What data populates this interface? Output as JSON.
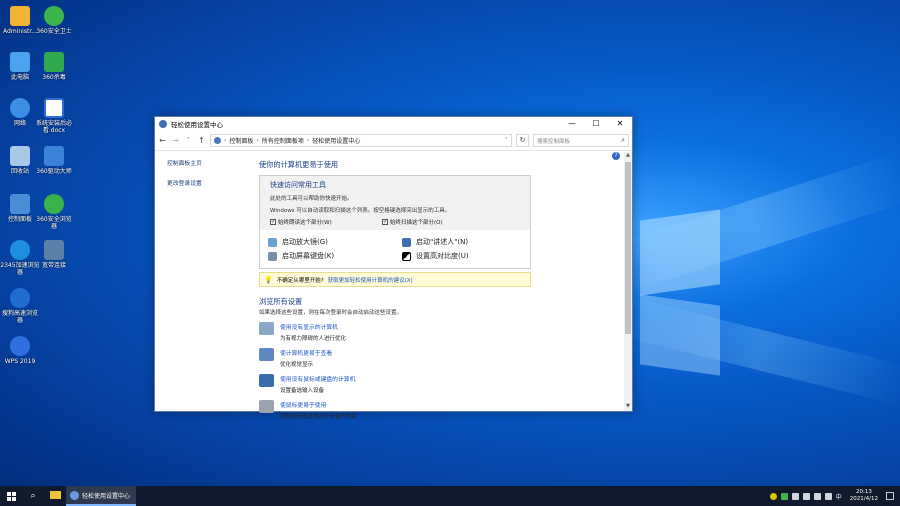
{
  "desktop": {
    "icons": [
      {
        "label": "Administr...",
        "color": "#f2b233"
      },
      {
        "label": "360安全卫士",
        "color": "#3bb54a"
      },
      {
        "label": "此电脑",
        "color": "#4aa3f0"
      },
      {
        "label": "360杀毒",
        "color": "#2fa84f"
      },
      {
        "label": "网络",
        "color": "#3d8ee6"
      },
      {
        "label": "系统安装后必看.docx",
        "color": "#2f6fd4"
      },
      {
        "label": "回收站",
        "color": "#a8c8e8"
      },
      {
        "label": "360驱动大师",
        "color": "#3b83d9"
      },
      {
        "label": "控制面板",
        "color": "#4a8ed8"
      },
      {
        "label": "360安全浏览器",
        "color": "#39b34a"
      },
      {
        "label": "2345加速浏览器",
        "color": "#1e8ee0"
      },
      {
        "label": "宽带连接",
        "color": "#5c7fa8"
      },
      {
        "label": "搜狗高速浏览器",
        "color": "#1f6ecf"
      },
      {
        "label": "WPS 2019",
        "color": "#2f6fe0"
      }
    ]
  },
  "window": {
    "title": "轻松使用设置中心",
    "controls": {
      "minimize": "—",
      "maximize": "☐",
      "close": "✕"
    },
    "address": {
      "crumbs": [
        "控制面板",
        "所有控制面板项",
        "轻松使用设置中心"
      ],
      "sep": "›",
      "search_placeholder": "搜索控制面板"
    },
    "leftnav": [
      "控制面板主页",
      "更改登录设置"
    ],
    "main": {
      "heading": "使你的计算机更易于使用",
      "quick": {
        "title": "快速访问常用工具",
        "line1": "此处的工具可以帮助你快速开始。",
        "line2": "Windows 可以自动读取和扫描这个列表。按空格键选择突出显示的工具。",
        "check1": "始终朗读这个部分(W)",
        "check2": "始终扫描这个部分(O)",
        "tools": [
          "启动放大镜(G)",
          "启动\"讲述人\"(N)",
          "启动屏幕键盘(K)",
          "设置高对比度(U)"
        ]
      },
      "tip": {
        "prefix": "不确定从哪里开始?",
        "link": "获取更加轻松使用计算机的建议(X)"
      },
      "browse": {
        "title": "浏览所有设置",
        "sub": "如果选择这些设置，则在每次登录时会自动启动这些设置。",
        "items": [
          {
            "link": "使用没有显示的计算机",
            "desc": "为有视力障碍的人进行优化"
          },
          {
            "link": "使计算机更易于查看",
            "desc": "优化视觉显示"
          },
          {
            "link": "使用没有鼠标或键盘的计算机",
            "desc": "设置备选输入设备"
          },
          {
            "link": "使鼠标更易于使用",
            "desc": "调整鼠标或其他指针设备的设置"
          }
        ]
      }
    }
  },
  "taskbar": {
    "app_label": "轻松使用设置中心",
    "ime": "中",
    "time": "20:13",
    "date": "2021/4/12"
  }
}
